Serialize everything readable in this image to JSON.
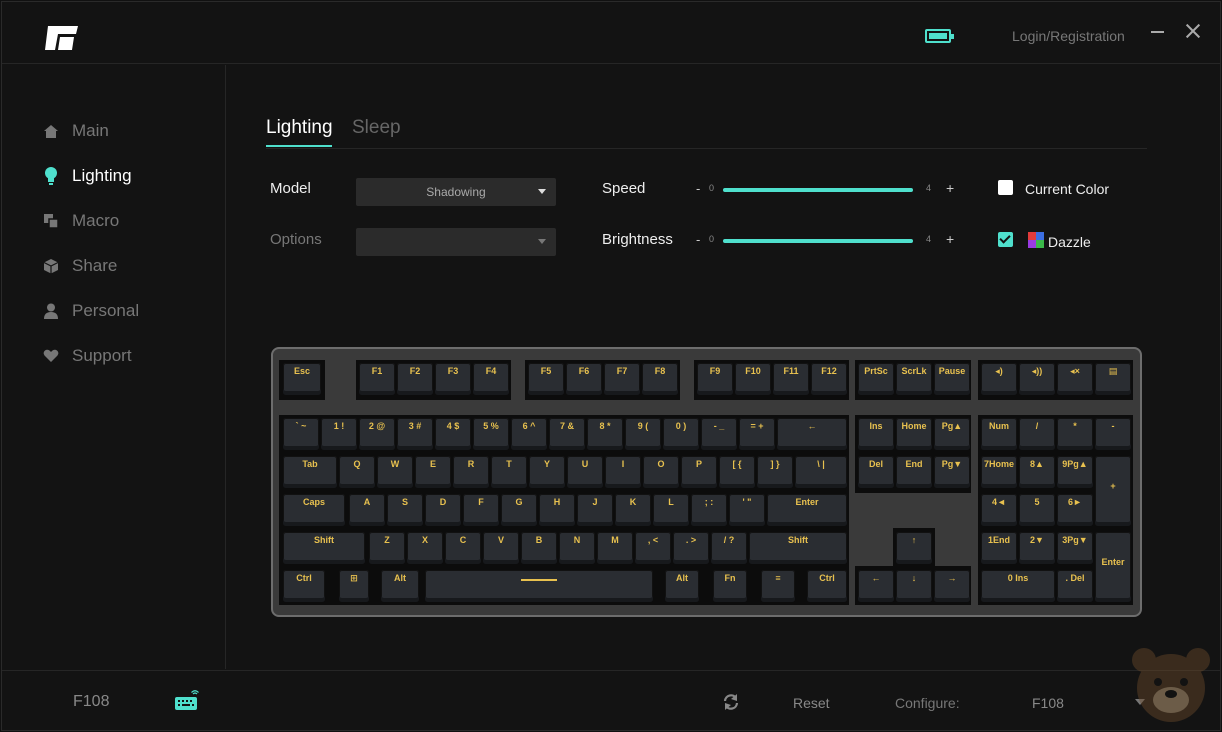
{
  "header": {
    "login_label": "Login/Registration"
  },
  "sidebar": {
    "items": [
      {
        "label": "Main",
        "icon": "home-icon"
      },
      {
        "label": "Lighting",
        "icon": "lightbulb-icon"
      },
      {
        "label": "Macro",
        "icon": "macro-icon"
      },
      {
        "label": "Share",
        "icon": "cube-icon"
      },
      {
        "label": "Personal",
        "icon": "person-icon"
      },
      {
        "label": "Support",
        "icon": "heart-icon"
      }
    ],
    "active": "Lighting"
  },
  "tabs": [
    "Lighting",
    "Sleep"
  ],
  "active_tab": "Lighting",
  "settings": {
    "model_label": "Model",
    "model_value": "Shadowing",
    "options_label": "Options",
    "options_value": "",
    "speed_label": "Speed",
    "speed_minus": "-",
    "speed_min": "0",
    "speed_max": "4",
    "speed_plus": "+",
    "brightness_label": "Brightness",
    "brightness_minus": "-",
    "brightness_min": "0",
    "brightness_max": "4",
    "brightness_plus": "+",
    "current_color_label": "Current Color",
    "dazzle_label": "Dazzle",
    "dazzle_checked": true,
    "current_color_checked": false
  },
  "colors": {
    "accent": "#4fe0cd",
    "key_legend": "#e8c14f"
  },
  "keys": {
    "esc": "Esc",
    "f1": "F1",
    "f2": "F2",
    "f3": "F3",
    "f4": "F4",
    "f5": "F5",
    "f6": "F6",
    "f7": "F7",
    "f8": "F8",
    "f9": "F9",
    "f10": "F10",
    "f11": "F11",
    "f12": "F12",
    "prtsc": "PrtSc",
    "scrlk": "ScrLk",
    "pause": "Pause",
    "num_row": [
      "` ~",
      "1 !",
      "2 @",
      "3 #",
      "4 $",
      "5 %",
      "6 ^",
      "7 &",
      "8 *",
      "9 (",
      "0 )",
      "- _",
      "= +"
    ],
    "backspace": "←",
    "tab": "Tab",
    "q_row": [
      "Q",
      "W",
      "E",
      "R",
      "T",
      "Y",
      "U",
      "I",
      "O",
      "P",
      "[ {",
      "] }",
      "\\ |"
    ],
    "caps": "Caps",
    "a_row": [
      "A",
      "S",
      "D",
      "F",
      "G",
      "H",
      "J",
      "K",
      "L",
      "; :",
      "' \""
    ],
    "enter": "Enter",
    "shift": "Shift",
    "z_row": [
      "Z",
      "X",
      "C",
      "V",
      "B",
      "N",
      "M",
      ", <",
      ". >",
      "/ ?"
    ],
    "ctrl": "Ctrl",
    "alt": "Alt",
    "fn": "Fn",
    "ins": "Ins",
    "home": "Home",
    "pgup": "Pg▲",
    "del": "Del",
    "end": "End",
    "pgdn": "Pg▼",
    "numlock": "Num",
    "np_div": "/",
    "np_mul": "*",
    "np_minus": "-",
    "np_row1": [
      "7Home",
      "8▲",
      "9Pg▲"
    ],
    "np_plus": "+",
    "np_row2": [
      "4◄",
      "5",
      "6►"
    ],
    "np_row3": [
      "1End",
      "2▼",
      "3Pg▼"
    ],
    "np_enter": "Enter",
    "np_0": "0 Ins",
    "np_dot": ". Del"
  },
  "footer": {
    "model": "F108",
    "reset_label": "Reset",
    "configure_label": "Configure:",
    "configure_value": "F108"
  }
}
